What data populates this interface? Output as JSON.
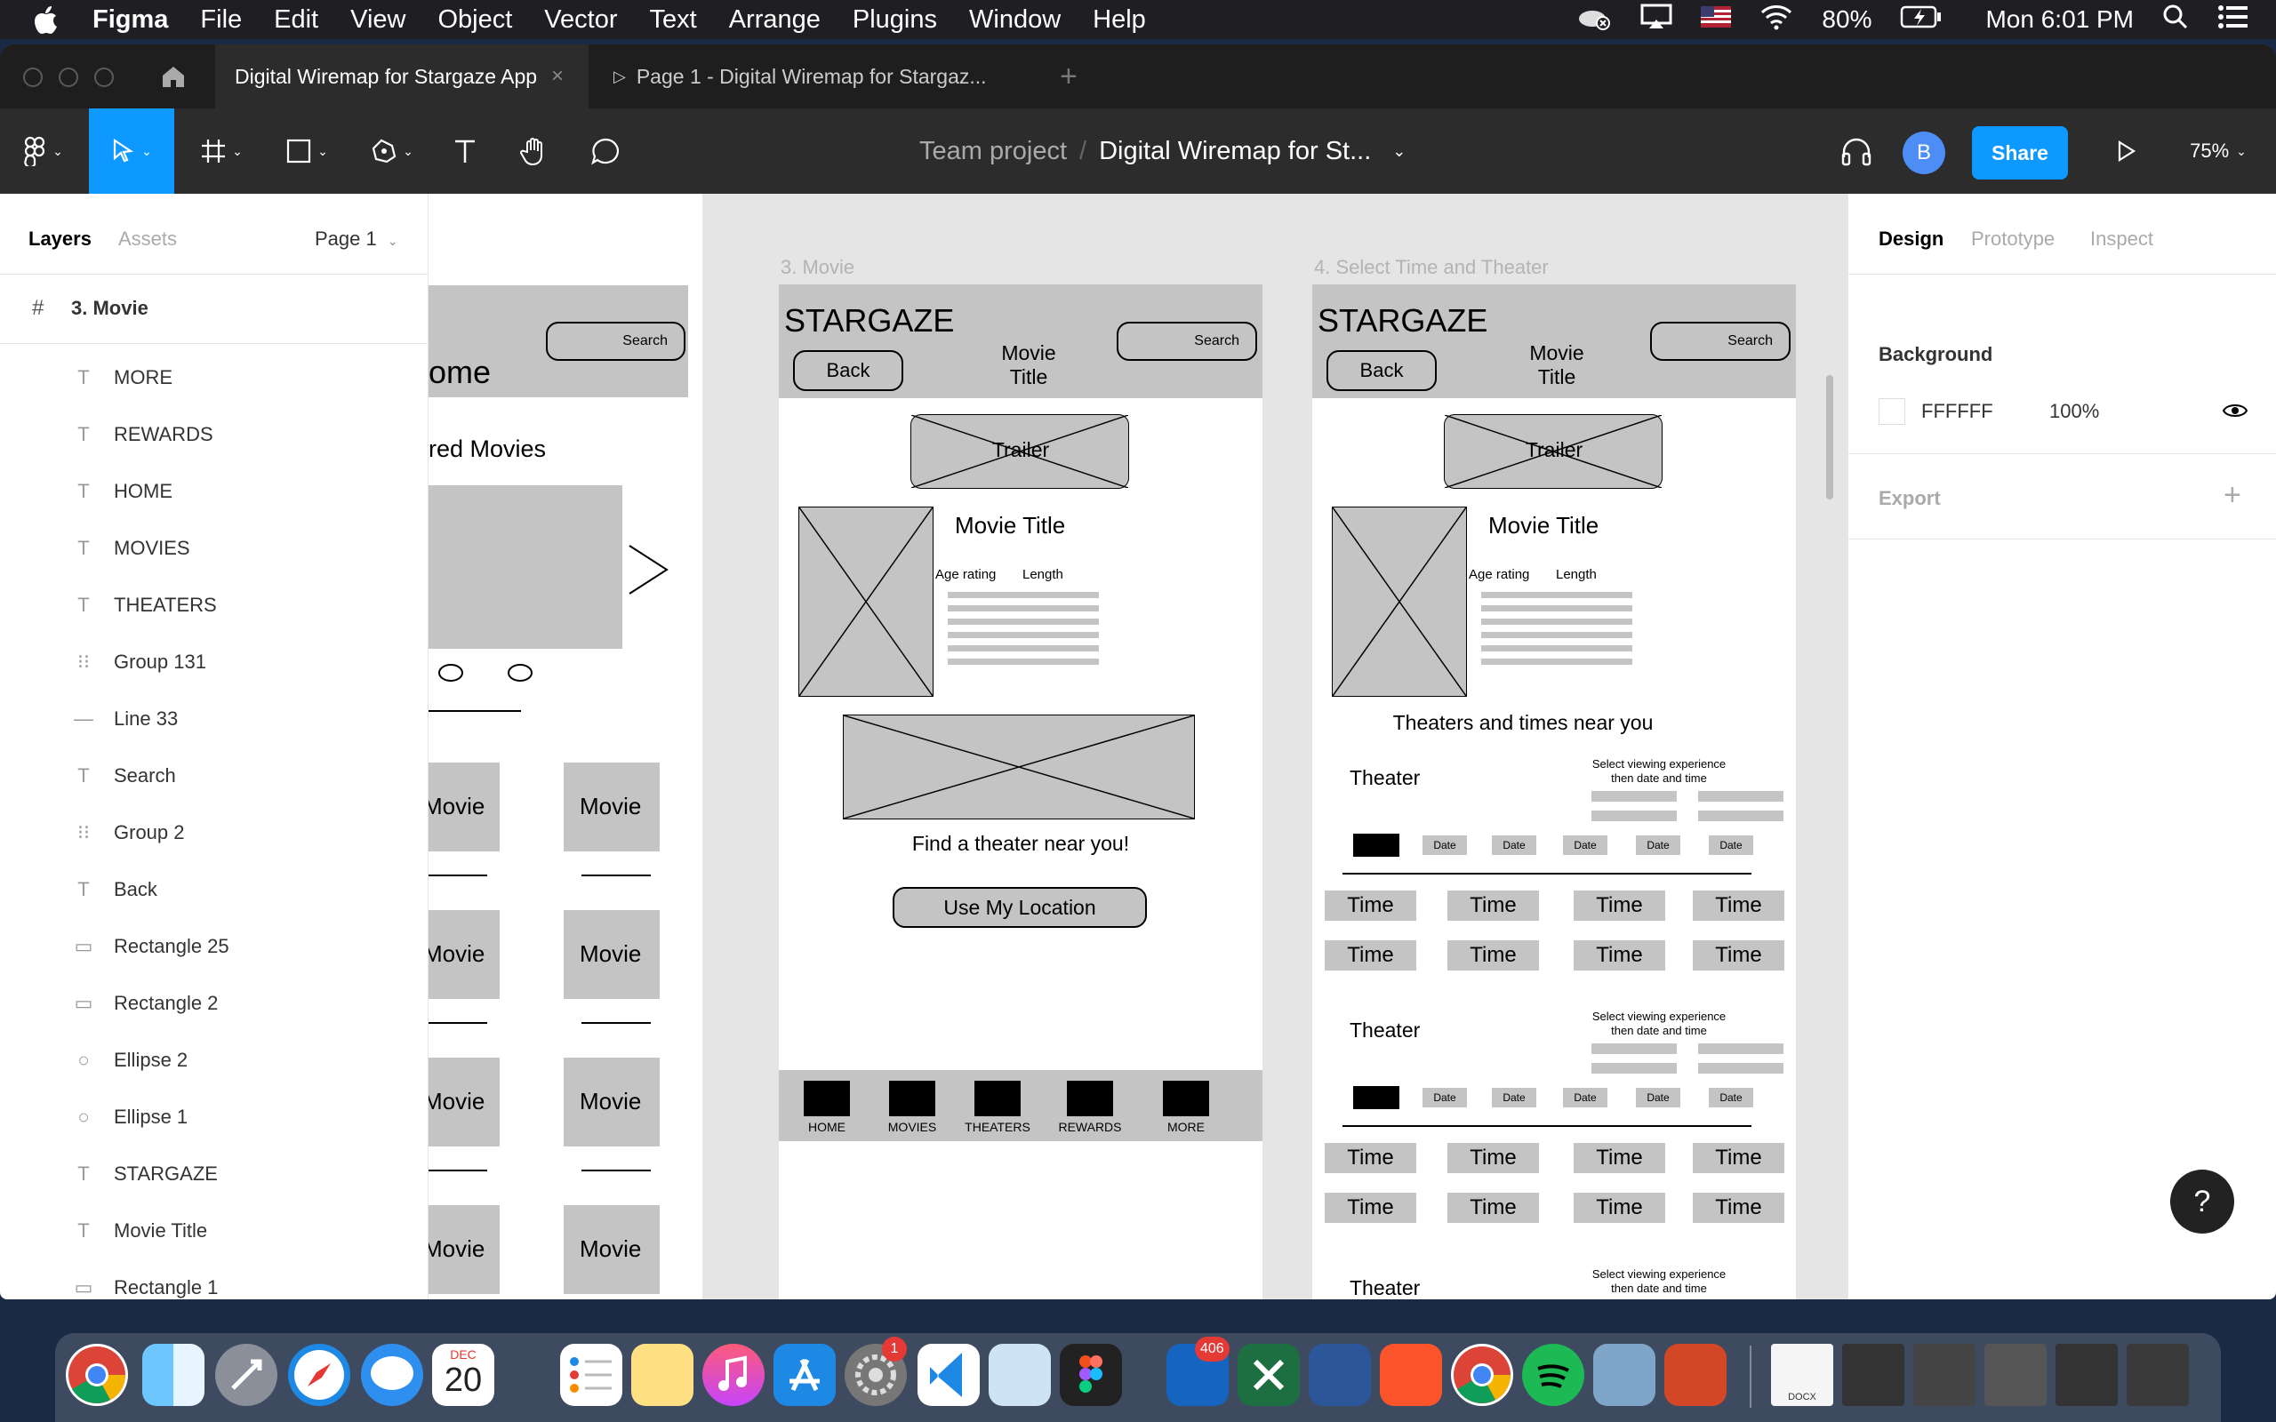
{
  "menubar": {
    "app": "Figma",
    "items": [
      "File",
      "Edit",
      "View",
      "Object",
      "Vector",
      "Text",
      "Arrange",
      "Plugins",
      "Window",
      "Help"
    ],
    "battery": "80%",
    "clock": "Mon 6:01 PM"
  },
  "tabs": {
    "active": "Digital Wiremap for Stargaze App",
    "prototype": "Page 1 - Digital Wiremap for Stargaz..."
  },
  "toolbar": {
    "breadcrumb_team": "Team project",
    "breadcrumb_sep": "/",
    "file_name": "Digital Wiremap for St...",
    "avatar_initial": "B",
    "share_label": "Share",
    "zoom": "75%"
  },
  "left_panel": {
    "tab_layers": "Layers",
    "tab_assets": "Assets",
    "page": "Page 1",
    "frame_name": "3. Movie",
    "layers": [
      {
        "icon": "T",
        "name": "MORE"
      },
      {
        "icon": "T",
        "name": "REWARDS"
      },
      {
        "icon": "T",
        "name": "HOME"
      },
      {
        "icon": "T",
        "name": "MOVIES"
      },
      {
        "icon": "T",
        "name": "THEATERS"
      },
      {
        "icon": "⁝⁝",
        "name": "Group 131"
      },
      {
        "icon": "—",
        "name": "Line 33"
      },
      {
        "icon": "T",
        "name": "Search"
      },
      {
        "icon": "⁝⁝",
        "name": "Group 2"
      },
      {
        "icon": "T",
        "name": "Back"
      },
      {
        "icon": "▭",
        "name": "Rectangle 25"
      },
      {
        "icon": "▭",
        "name": "Rectangle 2"
      },
      {
        "icon": "○",
        "name": "Ellipse 2"
      },
      {
        "icon": "○",
        "name": "Ellipse 1"
      },
      {
        "icon": "T",
        "name": "STARGAZE"
      },
      {
        "icon": "T",
        "name": "Movie Title"
      },
      {
        "icon": "▭",
        "name": "Rectangle 1"
      }
    ]
  },
  "right_panel": {
    "tab_design": "Design",
    "tab_prototype": "Prototype",
    "tab_inspect": "Inspect",
    "background_label": "Background",
    "bg_hex": "FFFFFF",
    "bg_opacity": "100%",
    "export_label": "Export",
    "help": "?"
  },
  "canvas": {
    "home_frame": {
      "title_partial": "ome",
      "search": "Search",
      "featured_partial": "red Movies",
      "movies_left": [
        "Movie",
        "Movie",
        "Movie",
        "Movie"
      ],
      "movies_right": [
        "Movie",
        "Movie",
        "Movie",
        "Movie"
      ]
    },
    "movie_frame": {
      "label": "3. Movie",
      "brand": "STARGAZE",
      "back": "Back",
      "search": "Search",
      "header_title": "Movie\nTitle",
      "trailer": "Trailer",
      "movie_title": "Movie Title",
      "age_rating": "Age rating",
      "length": "Length",
      "find_theater": "Find a theater near you!",
      "use_location": "Use My Location",
      "nav": [
        "HOME",
        "MOVIES",
        "THEATERS",
        "REWARDS",
        "MORE"
      ]
    },
    "time_frame": {
      "label": "4. Select Time and Theater",
      "brand": "STARGAZE",
      "back": "Back",
      "search": "Search",
      "header_title": "Movie\nTitle",
      "trailer": "Trailer",
      "movie_title": "Movie Title",
      "age_rating": "Age rating",
      "length": "Length",
      "section_heading": "Theaters and times near you",
      "theater": "Theater",
      "select_hint": "Select viewing experience\nthen date and time",
      "date": "Date",
      "time": "Time"
    }
  },
  "dock": {
    "calendar_month": "DEC",
    "calendar_day": "20",
    "badge_settings": "1",
    "badge_outlook": "406",
    "docx_label": "DOCX"
  }
}
